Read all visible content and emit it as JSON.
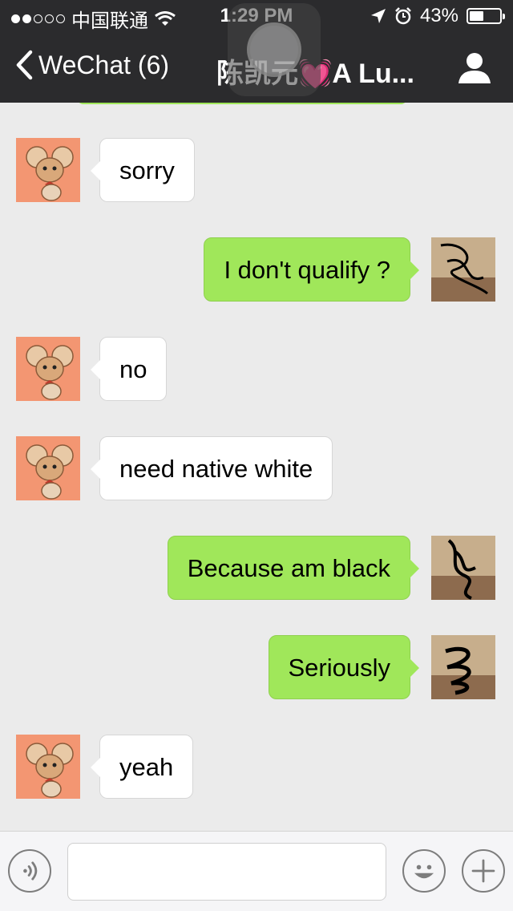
{
  "status_bar": {
    "carrier": "中国联通",
    "time": "1:29 PM",
    "battery": "43%",
    "battery_level": 0.43,
    "icons": [
      "signal-dots-icon",
      "wifi-icon",
      "location-arrow-icon",
      "alarm-icon",
      "battery-icon"
    ]
  },
  "nav": {
    "back_label": "WeChat (6)",
    "title": "陈凯元💓A Lu...",
    "icons": [
      "chevron-left-icon",
      "profile-icon"
    ]
  },
  "messages": [
    {
      "sender": "peer",
      "text": "sorry"
    },
    {
      "sender": "me",
      "text": "I don't qualify ?"
    },
    {
      "sender": "peer",
      "text": "no"
    },
    {
      "sender": "peer",
      "text": "need native white"
    },
    {
      "sender": "me",
      "text": "Because am black"
    },
    {
      "sender": "me",
      "text": "Seriously"
    },
    {
      "sender": "peer",
      "text": "yeah"
    }
  ],
  "input_bar": {
    "value": "",
    "icons": [
      "voice-icon",
      "emoji-icon",
      "plus-icon"
    ]
  },
  "colors": {
    "nav_bg": "#2b2b2d",
    "chat_bg": "#ebebeb",
    "my_bubble": "#a0e75a",
    "peer_bubble": "#ffffff",
    "peer_avatar_bg": "#f39672"
  }
}
